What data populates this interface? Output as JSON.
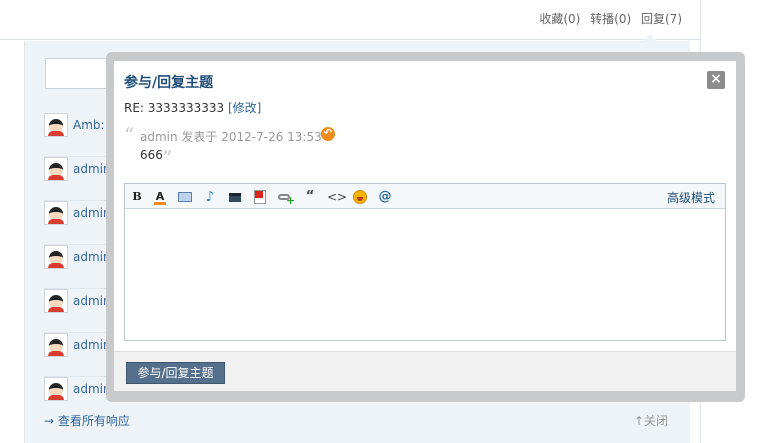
{
  "top_stats": {
    "favorites": "收藏(0)",
    "reposts": "转播(0)",
    "replies": "回复(7)"
  },
  "replies": [
    {
      "name": "Amb:"
    },
    {
      "name": "admin:"
    },
    {
      "name": "admin:"
    },
    {
      "name": "admin:"
    },
    {
      "name": "admin:"
    },
    {
      "name": "admin:"
    },
    {
      "name": "admin:"
    }
  ],
  "footer": {
    "view_all": "→ 查看所有响应",
    "close": "↑关闭"
  },
  "modal": {
    "title": "参与/回复主题",
    "close_glyph": "×",
    "re_text": "RE: 3333333333",
    "edit_label": "[修改]",
    "quote": {
      "open_mark": "“",
      "meta": "admin 发表于 2012-7-26 13:53",
      "text": "666",
      "close_mark": "”"
    },
    "toolbar": {
      "bold_label": "B",
      "color_label": "A",
      "music_glyph": "♪",
      "quote_glyph": "“",
      "code_glyph": "<>",
      "at_glyph": "@",
      "advanced_label": "高级模式"
    },
    "submit_label": "参与/回复主题"
  }
}
